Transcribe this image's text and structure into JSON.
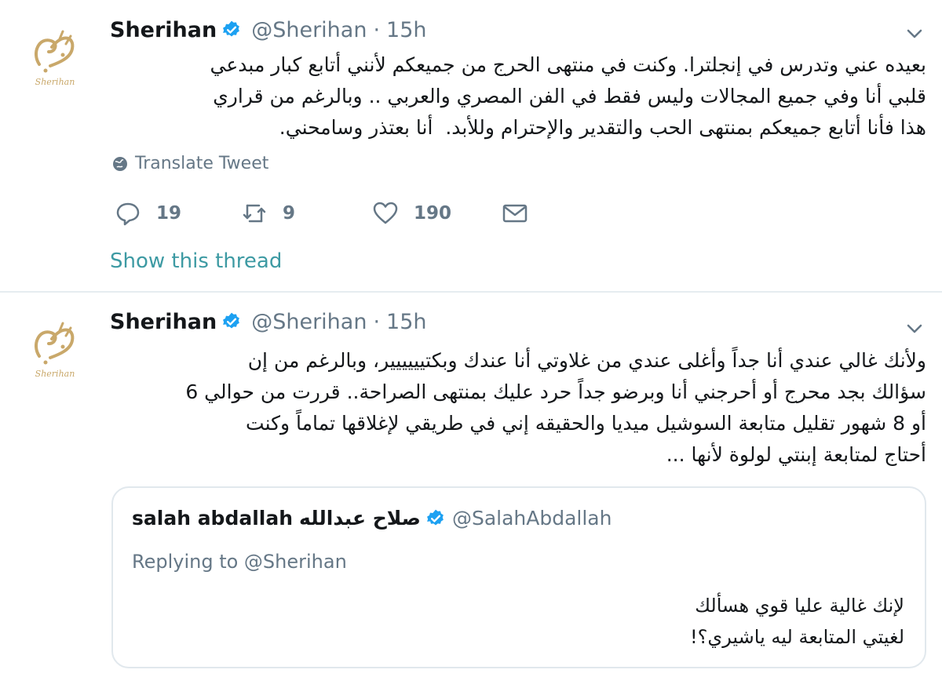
{
  "tweets": [
    {
      "name": "Sherihan",
      "handle": "@Sherihan",
      "separator": "·",
      "time": "15h",
      "text": "بعيده عني وتدرس في إنجلترا. وكنت في منتهى الحرج من جميعكم لأنني أتابع كبار مبدعي\nقلبي أنا وفي جميع المجالات وليس فقط في الفن المصري والعربي .. وبالرغم من قراري\nهذا فأنا أتابع جميعكم بمنتهى الحب والتقدير والإحترام وللأبد.  أنا بعتذر وسامحني.",
      "translate_label": "Translate Tweet",
      "actions": {
        "reply_count": "19",
        "retweet_count": "9",
        "like_count": "190"
      },
      "thread_link": "Show this thread"
    },
    {
      "name": "Sherihan",
      "handle": "@Sherihan",
      "separator": "·",
      "time": "15h",
      "text": "ولأنك غالي عندي أنا جداً وأغلى عندي من غلاوتي أنا عندك وبكتيييييير، وبالرغم من إن\nسؤالك بجد محرج أو أحرجني أنا وبرضو جداً حرد عليك بمنتهى الصراحة.. قررت من حوالي 6\nأو 8 شهور تقليل متابعة السوشيل ميديا والحقيقه إني في طريقي لإغلاقها تماماً وكنت\nأحتاج لمتابعة إبنتي لولوة لأنها ...",
      "quote": {
        "name": "salah abdallah",
        "name_ar": "صلاح عبدالله",
        "handle": "@SalahAbdallah",
        "replying": "Replying to @Sherihan",
        "text": "لإنك غالية عليا قوي هسألك\nلغيتي المتابعة ليه ياشيري؟!"
      }
    }
  ],
  "colors": {
    "verified": "#1da1f2",
    "muted": "#657786",
    "link": "#3d9aa3",
    "avatar_gold": "#c9a86a"
  },
  "avatar_caption": "Sherihan"
}
